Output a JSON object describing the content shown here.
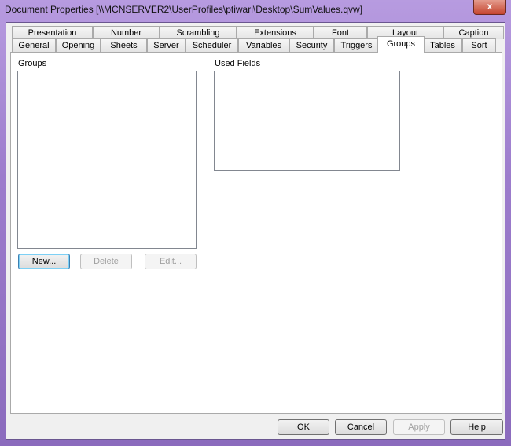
{
  "window": {
    "title": "Document Properties [\\\\MCNSERVER2\\UserProfiles\\ptiwari\\Desktop\\SumValues.qvw]",
    "close": "x"
  },
  "tabs_row1": [
    "Presentation",
    "Number",
    "Scrambling",
    "Extensions",
    "Font",
    "Layout",
    "Caption"
  ],
  "tabs_row2": [
    "General",
    "Opening",
    "Sheets",
    "Server",
    "Scheduler",
    "Variables",
    "Security",
    "Triggers",
    "Groups",
    "Tables",
    "Sort"
  ],
  "active_tab": "Groups",
  "groups": {
    "label": "Groups",
    "items": [],
    "new": "New...",
    "delete": "Delete",
    "edit": "Edit..."
  },
  "used_fields": {
    "label": "Used Fields",
    "items": []
  },
  "footer": {
    "ok": "OK",
    "cancel": "Cancel",
    "apply": "Apply",
    "help": "Help"
  }
}
